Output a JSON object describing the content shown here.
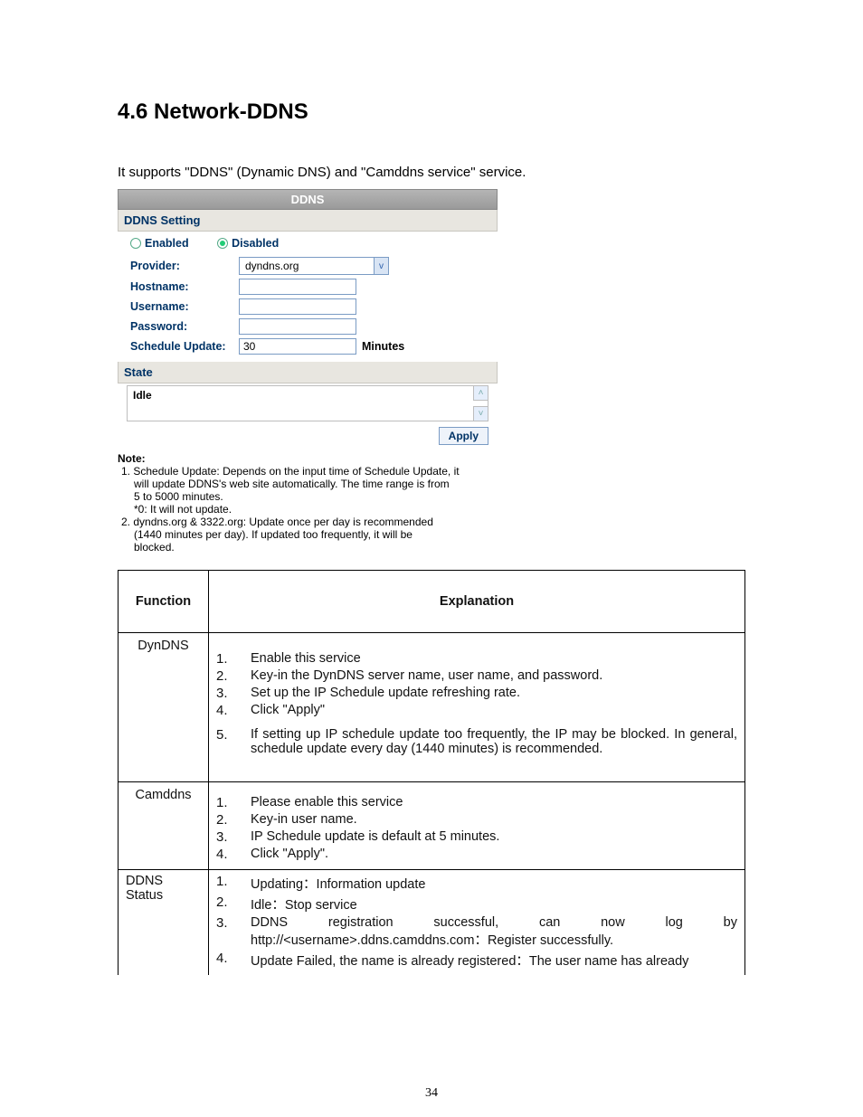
{
  "heading": "4.6 Network-DDNS",
  "intro": "It supports \"DDNS\" (Dynamic DNS) and \"Camddns service\" service.",
  "panel": {
    "title": "DDNS",
    "section1": "DDNS Setting",
    "enabled_label": "Enabled",
    "disabled_label": "Disabled",
    "provider_label": "Provider:",
    "provider_value": "dyndns.org",
    "hostname_label": "Hostname:",
    "hostname_value": "",
    "username_label": "Username:",
    "username_value": "",
    "password_label": "Password:",
    "password_value": "",
    "schedule_label": "Schedule Update:",
    "schedule_value": "30",
    "schedule_unit": "Minutes",
    "section2": "State",
    "state_text": "Idle",
    "apply": "Apply"
  },
  "note": {
    "head": "Note:",
    "item1": "1. Schedule Update: Depends on the input time of Schedule Update, it",
    "item1b": "will update DDNS's web site automatically. The time range is from",
    "item1c": "5 to 5000 minutes.",
    "item1d": "*0: It will not update.",
    "item2": "2. dyndns.org & 3322.org: Update once per day is recommended",
    "item2b": "(1440 minutes per day). If updated too frequently, it will be",
    "item2c": "blocked."
  },
  "table": {
    "h1": "Function",
    "h2": "Explanation",
    "r1_func": "DynDNS",
    "r1_items": [
      "Enable this service",
      "Key-in the DynDNS server name, user name, and password.",
      "Set up the IP Schedule update refreshing rate.",
      "Click \"Apply\"",
      "If setting up IP schedule update too frequently, the IP may be blocked. In general, schedule update every day (1440 minutes) is recommended."
    ],
    "r2_func": "Camddns",
    "r2_items": [
      "Please enable this service",
      "Key-in user name.",
      "IP Schedule update is default at 5 minutes.",
      "Click \"Apply\"."
    ],
    "r3_func": "DDNS Status",
    "r3_items": [
      "Updating：Information update",
      "Idle：Stop service",
      "DDNS registration successful, can now log by http://<username>.ddns.camddns.com：Register successfully.",
      "Update Failed, the name is already registered：The user name has already"
    ]
  },
  "pagenum": "34"
}
